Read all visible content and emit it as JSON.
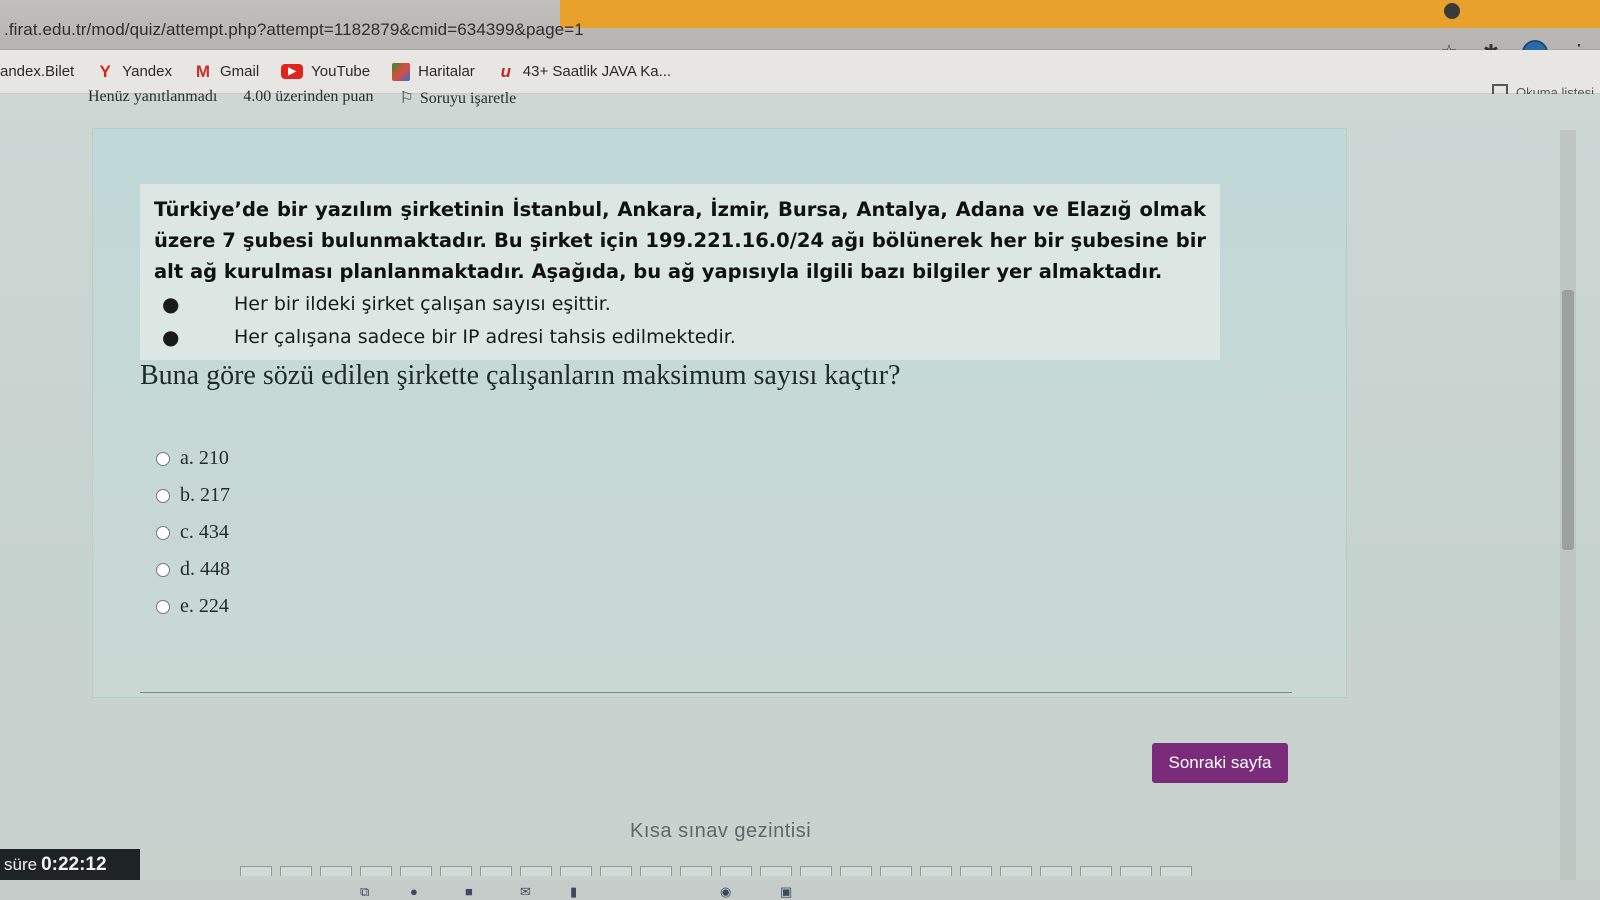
{
  "browser": {
    "url": ".firat.edu.tr/mod/quiz/attempt.php?attempt=1182879&cmid=634399&page=1",
    "reading_list_label": "Okuma listesi"
  },
  "bookmarks": [
    {
      "label": "andex.Bilet",
      "icon": "bookmark-icon"
    },
    {
      "label": "Yandex",
      "icon": "yandex-icon",
      "glyph": "Y"
    },
    {
      "label": "Gmail",
      "icon": "gmail-icon",
      "glyph": "M"
    },
    {
      "label": "YouTube",
      "icon": "youtube-icon",
      "glyph": "▶"
    },
    {
      "label": "Haritalar",
      "icon": "maps-icon",
      "glyph": ""
    },
    {
      "label": "43+ Saatlik JAVA Ka...",
      "icon": "udemy-icon",
      "glyph": "u"
    }
  ],
  "quiz_info": {
    "status": "Henüz yanıtlanmadı",
    "points": "4.00 üzerinden puan",
    "flag_label": "Soruyu işaretle"
  },
  "question": {
    "text": "Türkiye’de bir yazılım şirketinin İstanbul, Ankara, İzmir, Bursa, Antalya, Adana ve Elazığ olmak üzere 7 şubesi bulunmaktadır. Bu şirket için 199.221.16.0/24 ağı bölünerek her bir şubesine bir alt ağ kurulması planlanmaktadır. Aşağıda, bu ağ yapısıyla ilgili bazı bilgiler yer almaktadır.",
    "bullets": [
      "Her bir ildeki şirket çalışan sayısı eşittir.",
      "Her çalışana sadece bir IP adresi tahsis edilmektedir."
    ],
    "prompt": "Buna göre sözü edilen şirkette çalışanların maksimum sayısı kaçtır?"
  },
  "answers": [
    {
      "label": "a. 210"
    },
    {
      "label": "b. 217"
    },
    {
      "label": "c. 434"
    },
    {
      "label": "d. 448"
    },
    {
      "label": "e. 224"
    }
  ],
  "next_button": "Sonraki sayfa",
  "navigation_title": "Kısa sınav gezintisi",
  "timer": {
    "label": "süre",
    "value": "0:22:12"
  },
  "colors": {
    "next_button": "#7a2c7a",
    "timer_bg": "#1e2324",
    "tab_accent": "#e8a12a"
  }
}
